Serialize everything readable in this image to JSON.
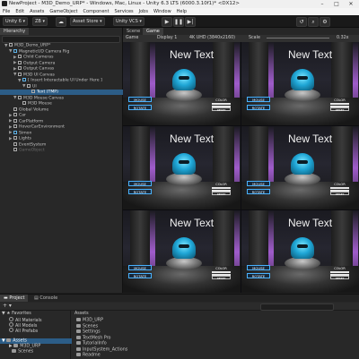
{
  "window": {
    "title": "NewProject - M3D_Demo_URP* - Windows, Mac, Linux - Unity 6.3 LTS (6000.3.10f1)* <DX12>",
    "min_glyph": "–",
    "max_glyph": "□",
    "close_glyph": "✕"
  },
  "menu": [
    "File",
    "Edit",
    "Assets",
    "GameObject",
    "Component",
    "Services",
    "Jobs",
    "Window",
    "Help"
  ],
  "toolbar": {
    "account": "Unity 6",
    "user_badge": "ZB",
    "asset_store": "Asset Store",
    "vcs": "Unity VCS"
  },
  "hierarchy": {
    "tab": "Hierarchy",
    "rows": [
      {
        "label": "M3D_Demo_URP*",
        "indent": 1,
        "arrow": "▼",
        "icon": "scene"
      },
      {
        "label": "MagneticUD Camera Rig",
        "indent": 2,
        "arrow": "▼",
        "icon": "blue"
      },
      {
        "label": "Child Cameras",
        "indent": 3,
        "arrow": "▶",
        "icon": "cube"
      },
      {
        "label": "Output Camera",
        "indent": 3,
        "arrow": "▶",
        "icon": "cube"
      },
      {
        "label": "Output Canvas",
        "indent": 3,
        "arrow": "▶",
        "icon": "cube"
      },
      {
        "label": "M3D UI Canvas",
        "indent": 3,
        "arrow": "▼",
        "icon": "cube"
      },
      {
        "label": "[ Insert Interactable UI Under Here ]",
        "indent": 4,
        "arrow": "▼",
        "icon": "blue"
      },
      {
        "label": "UI",
        "indent": 5,
        "arrow": "▼",
        "icon": "cube"
      },
      {
        "label": "Text (TMP)",
        "indent": 6,
        "arrow": "",
        "icon": "cube",
        "selected": true
      },
      {
        "label": "M3D Mouse Canvas",
        "indent": 3,
        "arrow": "▼",
        "icon": "cube"
      },
      {
        "label": "M3D Mouse",
        "indent": 4,
        "arrow": "",
        "icon": "cube"
      },
      {
        "label": "Global Volume",
        "indent": 2,
        "arrow": "",
        "icon": "cube"
      },
      {
        "label": "Car",
        "indent": 2,
        "arrow": "▶",
        "icon": "cube"
      },
      {
        "label": "CarPlatform",
        "indent": 2,
        "arrow": "▶",
        "icon": "cube"
      },
      {
        "label": "HoverCarEnvironment",
        "indent": 2,
        "arrow": "▶",
        "icon": "cube"
      },
      {
        "label": "Simon",
        "indent": 2,
        "arrow": "▶",
        "icon": "blue"
      },
      {
        "label": "Lights",
        "indent": 2,
        "arrow": "▶",
        "icon": "cube"
      },
      {
        "label": "EventSystem",
        "indent": 2,
        "arrow": "",
        "icon": "cube"
      },
      {
        "label": "GameObject",
        "indent": 2,
        "arrow": "",
        "icon": "cube",
        "dim": true
      }
    ]
  },
  "game": {
    "tabs": [
      "Scene",
      "Game"
    ],
    "mode": "Game",
    "display": "Display 1",
    "resolution": "4K UHD (3840x2160)",
    "scale_label": "Scale",
    "scale_value": "0.32x",
    "cell_text": "New Text",
    "btn_top": "MOUSE",
    "btn_bottom": "ROTATE",
    "panel_label": "COLOR",
    "panel_btn": "RESET"
  },
  "project": {
    "tabs": [
      "Project",
      "Console"
    ],
    "favorites_header": "Favorites",
    "favorites": [
      "All Materials",
      "All Models",
      "All Prefabs"
    ],
    "assets_header": "Assets",
    "assets_tree": [
      "M3D_URP",
      "Scenes"
    ],
    "breadcrumb": "Assets",
    "files": [
      "M3D_URP",
      "Scenes",
      "Settings",
      "TextMesh Pro",
      "TutorialInfo",
      "InputSystem_Actions",
      "Readme"
    ]
  }
}
